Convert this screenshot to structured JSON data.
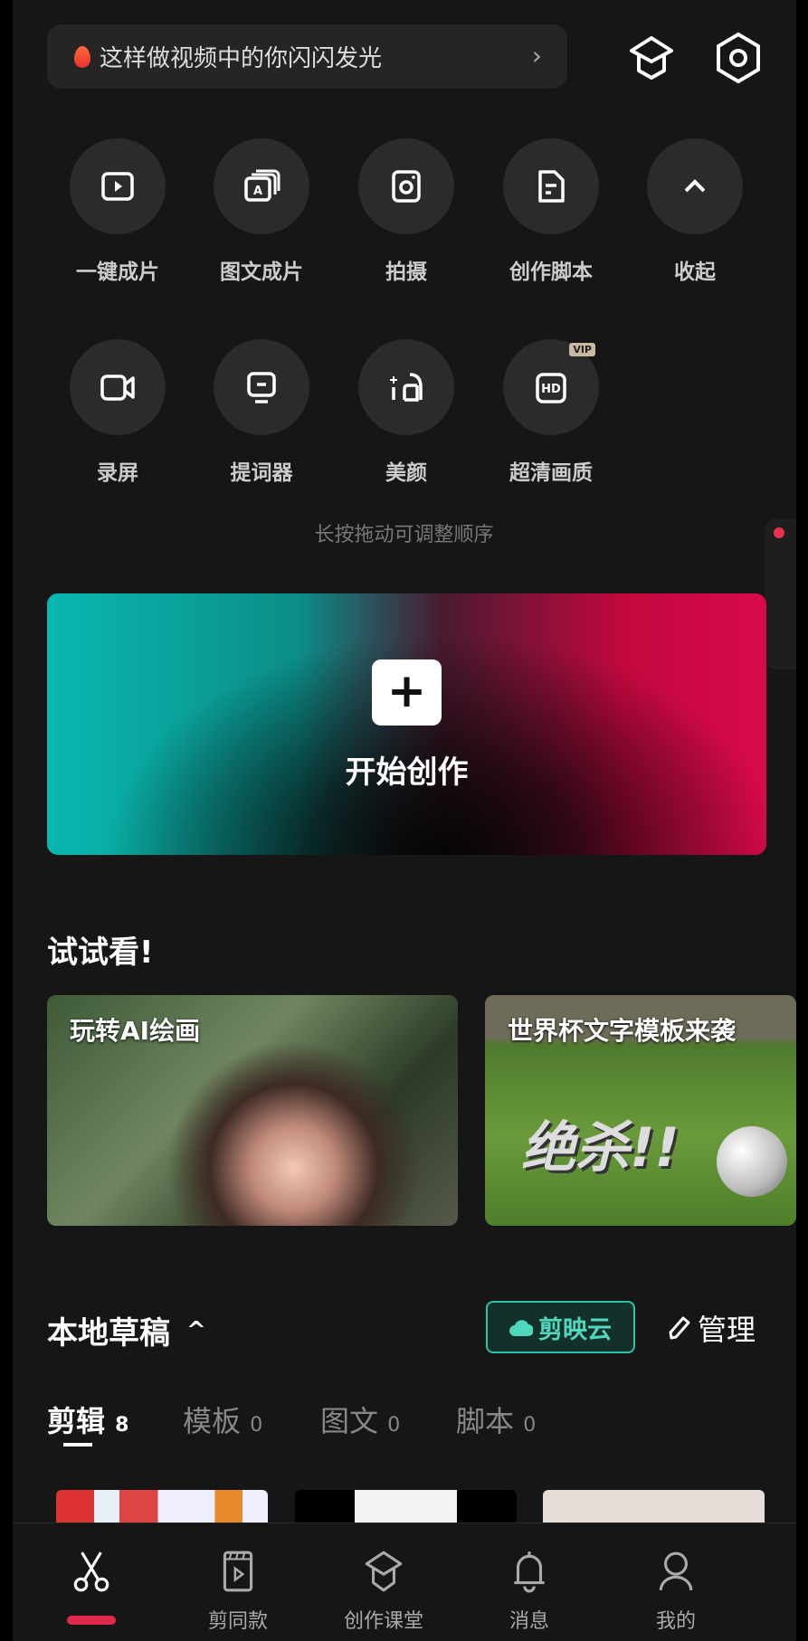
{
  "banner": {
    "text": "这样做视频中的你闪闪发光",
    "icon": "flame-icon"
  },
  "header_icons": [
    "graduation-cap-icon",
    "settings-hexagon-icon"
  ],
  "tools": [
    {
      "label": "一键成片",
      "icon": "play-square-icon"
    },
    {
      "label": "图文成片",
      "icon": "text-layers-icon"
    },
    {
      "label": "拍摄",
      "icon": "camera-icon"
    },
    {
      "label": "创作脚本",
      "icon": "script-document-icon"
    },
    {
      "label": "收起",
      "icon": "chevron-up-icon"
    },
    {
      "label": "录屏",
      "icon": "video-camera-icon"
    },
    {
      "label": "提词器",
      "icon": "teleprompter-icon"
    },
    {
      "label": "美颜",
      "icon": "beauty-icon"
    },
    {
      "label": "超清画质",
      "icon": "hd-icon",
      "badge": "VIP"
    }
  ],
  "hint": "长按拖动可调整顺序",
  "hero": {
    "label": "开始创作",
    "plus": "+"
  },
  "try": {
    "title": "试试看!",
    "cards": [
      {
        "title": "玩转AI绘画"
      },
      {
        "title": "世界杯文字模板来袭",
        "art_text": "绝杀!!"
      }
    ]
  },
  "drafts": {
    "title": "本地草稿",
    "cloud_label": "剪映云",
    "manage_label": "管理",
    "tabs": [
      {
        "label": "剪辑",
        "count": "8",
        "active": true
      },
      {
        "label": "模板",
        "count": "0"
      },
      {
        "label": "图文",
        "count": "0"
      },
      {
        "label": "脚本",
        "count": "0"
      }
    ]
  },
  "nav": [
    {
      "label": "",
      "icon": "scissors-icon",
      "active": true
    },
    {
      "label": "剪同款",
      "icon": "template-clip-icon"
    },
    {
      "label": "创作课堂",
      "icon": "graduation-cap-icon"
    },
    {
      "label": "消息",
      "icon": "bell-icon"
    },
    {
      "label": "我的",
      "icon": "user-icon"
    }
  ],
  "colors": {
    "accent": "#e0284f",
    "cloud": "#2bc3a5",
    "background": "#161616"
  }
}
